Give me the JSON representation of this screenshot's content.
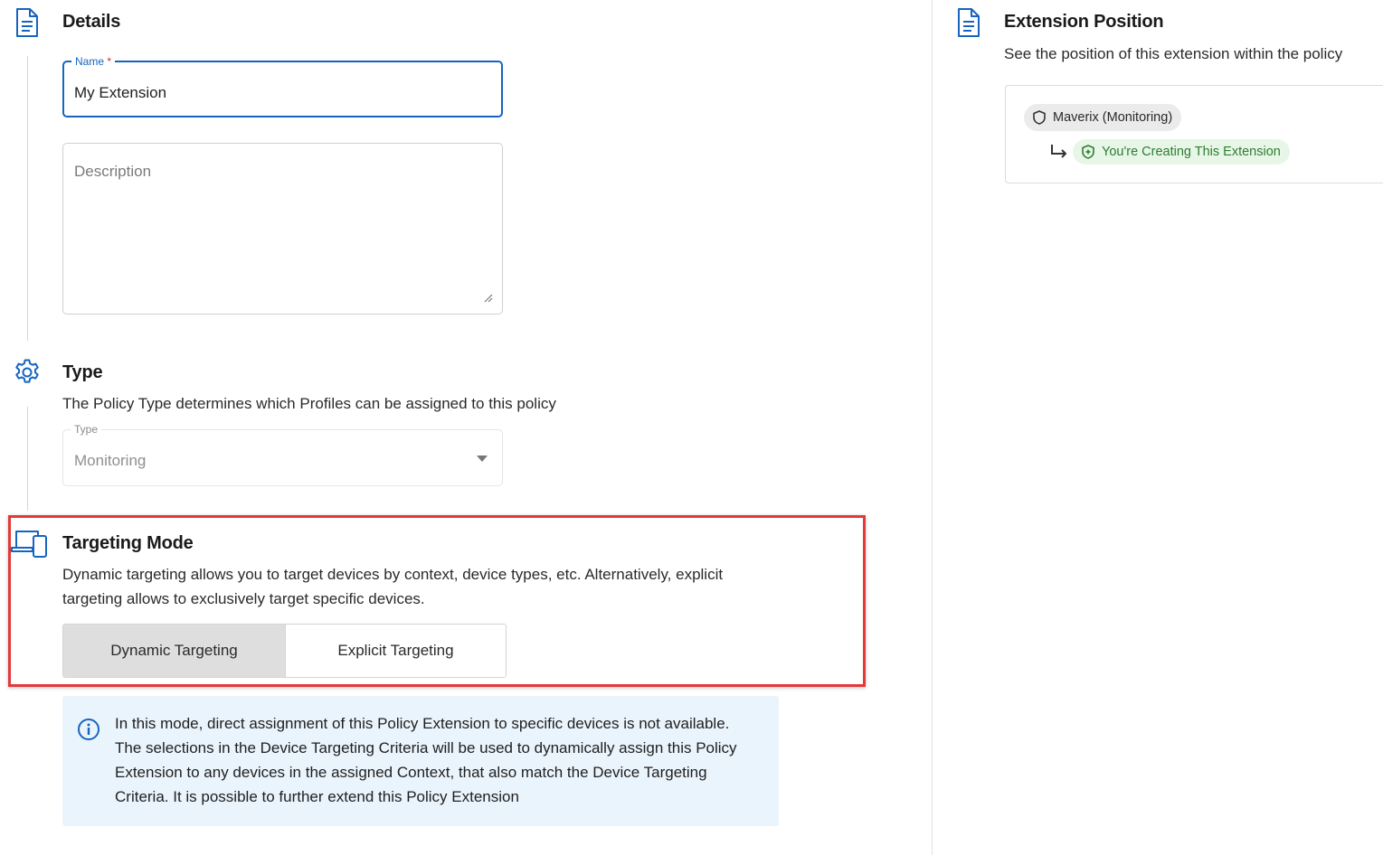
{
  "details": {
    "title": "Details",
    "name_field": {
      "label": "Name",
      "required_mark": "*",
      "value": "My Extension"
    },
    "description_field": {
      "placeholder": "Description",
      "value": ""
    }
  },
  "type_section": {
    "title": "Type",
    "description": "The Policy Type determines which Profiles can be assigned to this policy",
    "select": {
      "label": "Type",
      "value": "Monitoring"
    }
  },
  "targeting": {
    "title": "Targeting Mode",
    "description_line1": "Dynamic targeting allows you to target devices by context, device types, etc. Alternatively, explicit",
    "description_line2": "targeting allows to exclusively target specific devices.",
    "options": [
      {
        "label": "Dynamic Targeting",
        "selected": true
      },
      {
        "label": "Explicit Targeting",
        "selected": false
      }
    ],
    "info_lines": [
      "In this mode, direct assignment of this Policy Extension to specific devices is not available.",
      "The selections in the Device Targeting Criteria will be used to dynamically assign this Policy",
      "Extension to any devices in the assigned Context, that also match the Device Targeting",
      "Criteria. It is possible to further extend this Policy Extension"
    ]
  },
  "extension_position": {
    "title": "Extension Position",
    "subtitle": "See the position of this extension within the policy",
    "parent_chip": "Maverix (Monitoring)",
    "current_chip": "You're Creating This Extension"
  },
  "colors": {
    "accent": "#1565c0",
    "highlight": "#e23a3a",
    "info_bg": "#eaf4fc",
    "chip_green_text": "#2e7d32",
    "chip_green_bg": "#e8f6e7"
  },
  "icons": {
    "details": "document-icon",
    "type": "gear-icon",
    "targeting": "devices-icon",
    "info": "info-icon",
    "position": "document-icon",
    "parent_chip": "shield-icon",
    "current_chip": "shield-plus-icon",
    "arrow": "subdirectory-arrow-icon",
    "dropdown": "caret-down-icon"
  }
}
